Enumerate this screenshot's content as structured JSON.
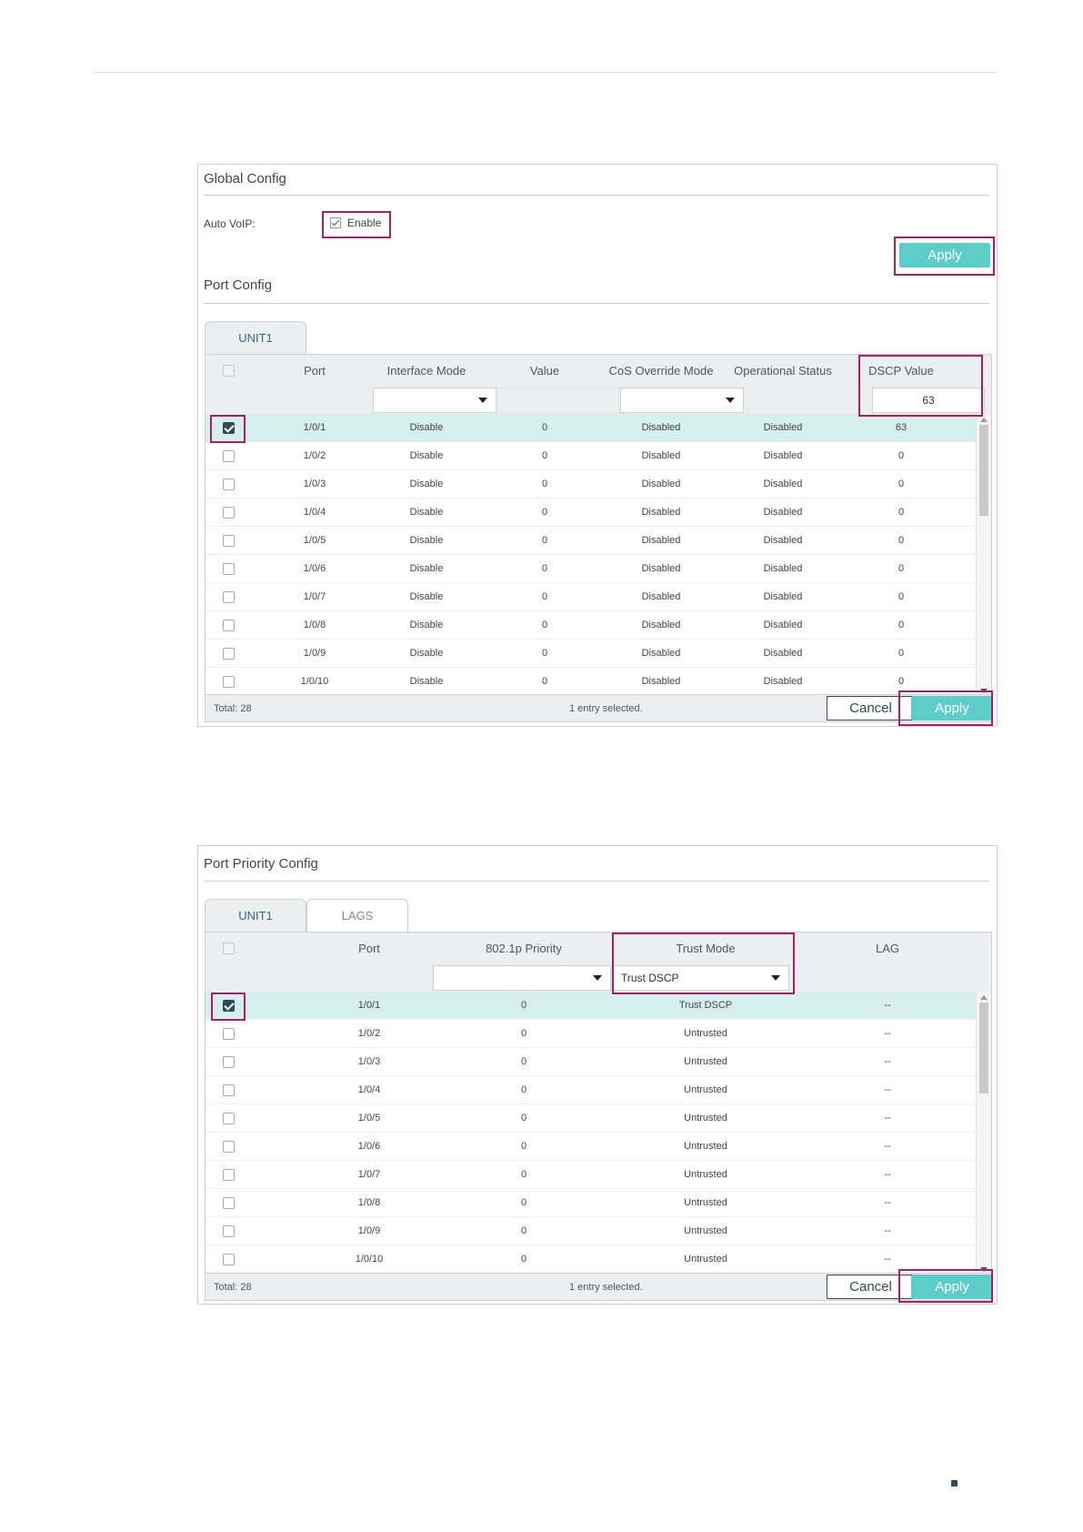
{
  "global_config": {
    "title": "Global Config",
    "auto_voip_label": "Auto VoIP:",
    "enable_label": "Enable",
    "apply_label": "Apply"
  },
  "port_config": {
    "title": "Port Config",
    "tab": "UNIT1",
    "columns": [
      "Port",
      "Interface Mode",
      "Value",
      "CoS Override Mode",
      "Operational Status",
      "DSCP Value"
    ],
    "filter_dscp": "63",
    "rows": [
      {
        "port": "1/0/1",
        "interface_mode": "Disable",
        "value": "0",
        "cos_override_mode": "Disabled",
        "operational_status": "Disabled",
        "dscp_value": "63",
        "checked": true
      },
      {
        "port": "1/0/2",
        "interface_mode": "Disable",
        "value": "0",
        "cos_override_mode": "Disabled",
        "operational_status": "Disabled",
        "dscp_value": "0",
        "checked": false
      },
      {
        "port": "1/0/3",
        "interface_mode": "Disable",
        "value": "0",
        "cos_override_mode": "Disabled",
        "operational_status": "Disabled",
        "dscp_value": "0",
        "checked": false
      },
      {
        "port": "1/0/4",
        "interface_mode": "Disable",
        "value": "0",
        "cos_override_mode": "Disabled",
        "operational_status": "Disabled",
        "dscp_value": "0",
        "checked": false
      },
      {
        "port": "1/0/5",
        "interface_mode": "Disable",
        "value": "0",
        "cos_override_mode": "Disabled",
        "operational_status": "Disabled",
        "dscp_value": "0",
        "checked": false
      },
      {
        "port": "1/0/6",
        "interface_mode": "Disable",
        "value": "0",
        "cos_override_mode": "Disabled",
        "operational_status": "Disabled",
        "dscp_value": "0",
        "checked": false
      },
      {
        "port": "1/0/7",
        "interface_mode": "Disable",
        "value": "0",
        "cos_override_mode": "Disabled",
        "operational_status": "Disabled",
        "dscp_value": "0",
        "checked": false
      },
      {
        "port": "1/0/8",
        "interface_mode": "Disable",
        "value": "0",
        "cos_override_mode": "Disabled",
        "operational_status": "Disabled",
        "dscp_value": "0",
        "checked": false
      },
      {
        "port": "1/0/9",
        "interface_mode": "Disable",
        "value": "0",
        "cos_override_mode": "Disabled",
        "operational_status": "Disabled",
        "dscp_value": "0",
        "checked": false
      },
      {
        "port": "1/0/10",
        "interface_mode": "Disable",
        "value": "0",
        "cos_override_mode": "Disabled",
        "operational_status": "Disabled",
        "dscp_value": "0",
        "checked": false
      }
    ],
    "footer": {
      "total": "Total: 28",
      "selected": "1 entry selected.",
      "cancel_label": "Cancel",
      "apply_label": "Apply"
    }
  },
  "port_priority_config": {
    "title": "Port Priority Config",
    "tabs": [
      "UNIT1",
      "LAGS"
    ],
    "columns": [
      "Port",
      "802.1p Priority",
      "Trust Mode",
      "LAG"
    ],
    "filter_trust_mode": "Trust DSCP",
    "rows": [
      {
        "port": "1/0/1",
        "priority": "0",
        "trust_mode": "Trust DSCP",
        "lag": "--",
        "checked": true
      },
      {
        "port": "1/0/2",
        "priority": "0",
        "trust_mode": "Untrusted",
        "lag": "--",
        "checked": false
      },
      {
        "port": "1/0/3",
        "priority": "0",
        "trust_mode": "Untrusted",
        "lag": "--",
        "checked": false
      },
      {
        "port": "1/0/4",
        "priority": "0",
        "trust_mode": "Untrusted",
        "lag": "--",
        "checked": false
      },
      {
        "port": "1/0/5",
        "priority": "0",
        "trust_mode": "Untrusted",
        "lag": "--",
        "checked": false
      },
      {
        "port": "1/0/6",
        "priority": "0",
        "trust_mode": "Untrusted",
        "lag": "--",
        "checked": false
      },
      {
        "port": "1/0/7",
        "priority": "0",
        "trust_mode": "Untrusted",
        "lag": "--",
        "checked": false
      },
      {
        "port": "1/0/8",
        "priority": "0",
        "trust_mode": "Untrusted",
        "lag": "--",
        "checked": false
      },
      {
        "port": "1/0/9",
        "priority": "0",
        "trust_mode": "Untrusted",
        "lag": "--",
        "checked": false
      },
      {
        "port": "1/0/10",
        "priority": "0",
        "trust_mode": "Untrusted",
        "lag": "--",
        "checked": false
      }
    ],
    "footer": {
      "total": "Total: 28",
      "selected": "1 entry selected.",
      "cancel_label": "Cancel",
      "apply_label": "Apply"
    }
  },
  "colors": {
    "accent_teal": "#5ccdc8",
    "highlight": "#a81f64",
    "selected_row": "#d5f0ec",
    "dark_blue": "#2e4a5c"
  }
}
